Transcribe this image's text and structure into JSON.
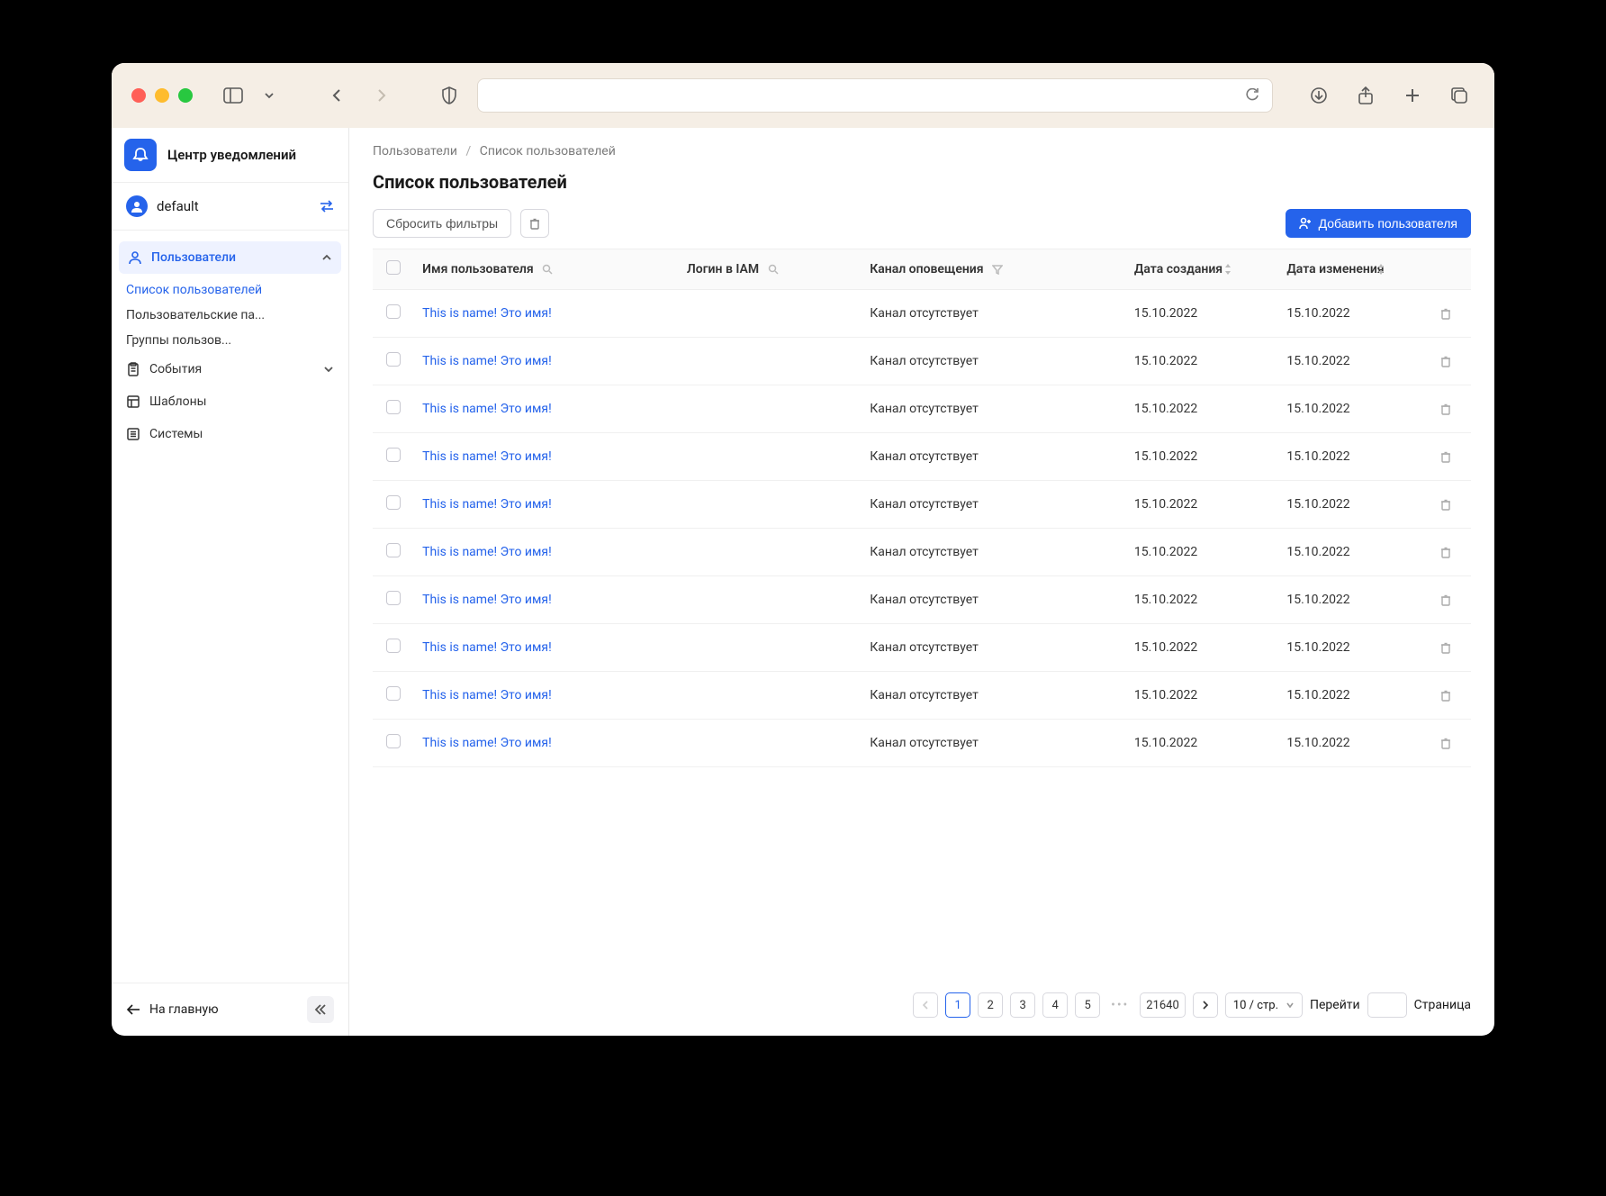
{
  "sidebar": {
    "app_title": "Центр уведомлений",
    "user": "default",
    "nav": {
      "users": "Пользователи",
      "users_sub": [
        "Список пользователей",
        "Пользовательские па...",
        "Группы пользов..."
      ],
      "events": "События",
      "templates": "Шаблоны",
      "systems": "Системы"
    },
    "home": "На главную"
  },
  "breadcrumb": {
    "a": "Пользователи",
    "b": "Список пользователей"
  },
  "page_title": "Список пользователей",
  "toolbar": {
    "reset": "Сбросить фильтры",
    "add": "Добавить пользователя"
  },
  "columns": {
    "name": "Имя пользователя",
    "login": "Логин в IAM",
    "channel": "Канал оповещения",
    "created": "Дата создания",
    "modified": "Дата изменения"
  },
  "rows": [
    {
      "name": "This is name! Это имя!",
      "login": "",
      "channel": "Канал отсутствует",
      "created": "15.10.2022",
      "modified": "15.10.2022"
    },
    {
      "name": "This is name! Это имя!",
      "login": "",
      "channel": "Канал отсутствует",
      "created": "15.10.2022",
      "modified": "15.10.2022"
    },
    {
      "name": "This is name! Это имя!",
      "login": "",
      "channel": "Канал отсутствует",
      "created": "15.10.2022",
      "modified": "15.10.2022"
    },
    {
      "name": "This is name! Это имя!",
      "login": "",
      "channel": "Канал отсутствует",
      "created": "15.10.2022",
      "modified": "15.10.2022"
    },
    {
      "name": "This is name! Это имя!",
      "login": "",
      "channel": "Канал отсутствует",
      "created": "15.10.2022",
      "modified": "15.10.2022"
    },
    {
      "name": "This is name! Это имя!",
      "login": "",
      "channel": "Канал отсутствует",
      "created": "15.10.2022",
      "modified": "15.10.2022"
    },
    {
      "name": "This is name! Это имя!",
      "login": "",
      "channel": "Канал отсутствует",
      "created": "15.10.2022",
      "modified": "15.10.2022"
    },
    {
      "name": "This is name! Это имя!",
      "login": "",
      "channel": "Канал отсутствует",
      "created": "15.10.2022",
      "modified": "15.10.2022"
    },
    {
      "name": "This is name! Это имя!",
      "login": "",
      "channel": "Канал отсутствует",
      "created": "15.10.2022",
      "modified": "15.10.2022"
    },
    {
      "name": "This is name! Это имя!",
      "login": "",
      "channel": "Канал отсутствует",
      "created": "15.10.2022",
      "modified": "15.10.2022"
    }
  ],
  "pagination": {
    "pages": [
      "1",
      "2",
      "3",
      "4",
      "5"
    ],
    "last": "21640",
    "size_label": "10 / стр.",
    "goto": "Перейти",
    "page_word": "Страница"
  }
}
